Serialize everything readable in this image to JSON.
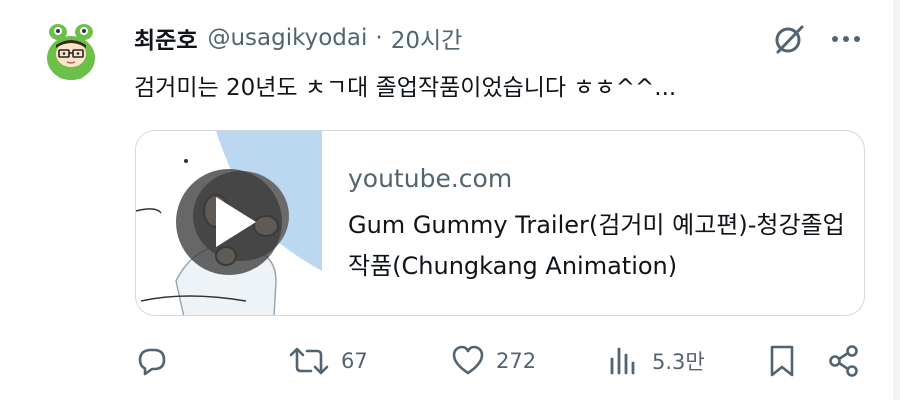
{
  "author": {
    "display_name": "최준호",
    "handle": "@usagikyodai",
    "separator": "·",
    "time": "20시간"
  },
  "tweet": {
    "text": "검거미는 20년도 ㅊㄱ대 졸업작품이었습니다 ㅎㅎ^^..."
  },
  "link_card": {
    "domain": "youtube.com",
    "title": "Gum Gummy Trailer(검거미 예고편)-청강졸업작품(Chungkang Animation)"
  },
  "actions": {
    "reply_count": "",
    "retweet_count": "67",
    "like_count": "272",
    "views_count": "5.3만"
  },
  "icons": {
    "grok": "grok-icon",
    "more": "more-icon",
    "play": "play-icon",
    "reply": "reply-icon",
    "retweet": "retweet-icon",
    "like": "heart-icon",
    "views": "views-icon",
    "bookmark": "bookmark-icon",
    "share": "share-icon"
  },
  "colors": {
    "text_primary": "#0f1419",
    "text_secondary": "#536471",
    "border": "#cfd9de",
    "avatar_green": "#5cb85c"
  }
}
